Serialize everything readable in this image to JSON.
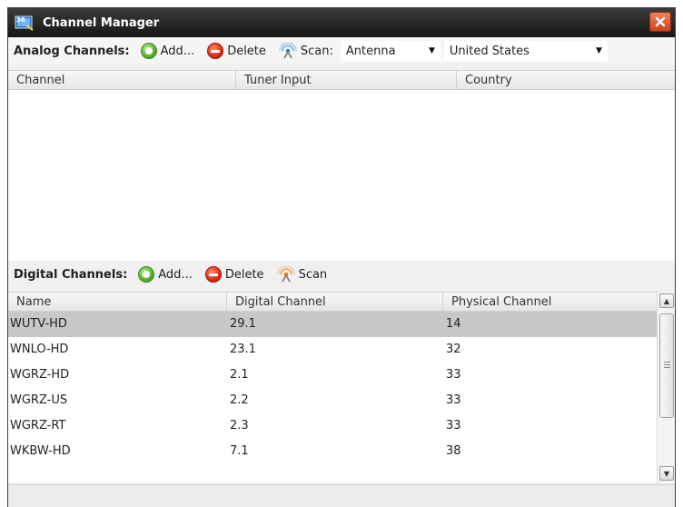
{
  "window": {
    "title": "Channel Manager",
    "close_glyph": "✕"
  },
  "analog": {
    "label": "Analog Channels:",
    "add_label": "Add...",
    "delete_label": "Delete",
    "scan_label": "Scan:",
    "source_select": "Antenna",
    "country_select": "United States",
    "columns": [
      "Channel",
      "Tuner Input",
      "Country"
    ],
    "rows": []
  },
  "digital": {
    "label": "Digital Channels:",
    "add_label": "Add...",
    "delete_label": "Delete",
    "scan_label": "Scan",
    "columns": [
      "Name",
      "Digital Channel",
      "Physical Channel"
    ],
    "rows": [
      {
        "name": "WUTV-HD",
        "digital": "29.1",
        "physical": "14",
        "selected": true
      },
      {
        "name": "WNLO-HD",
        "digital": "23.1",
        "physical": "32"
      },
      {
        "name": "WGRZ-HD",
        "digital": "2.1",
        "physical": "33"
      },
      {
        "name": "WGRZ-US",
        "digital": "2.2",
        "physical": "33"
      },
      {
        "name": "WGRZ-RT",
        "digital": "2.3",
        "physical": "33"
      },
      {
        "name": "WKBW-HD",
        "digital": "7.1",
        "physical": "38"
      }
    ]
  },
  "icons": {
    "app": "channel-manager-icon",
    "add": "add-icon",
    "delete": "delete-icon",
    "scan": "scan-antenna-icon",
    "close": "close-icon"
  },
  "colors": {
    "titlebar": "#1e1e1e",
    "close_button": "#e05a35",
    "selected_row": "#c8c8c8",
    "add_green": "#4aa220",
    "delete_red": "#d81e0a"
  }
}
